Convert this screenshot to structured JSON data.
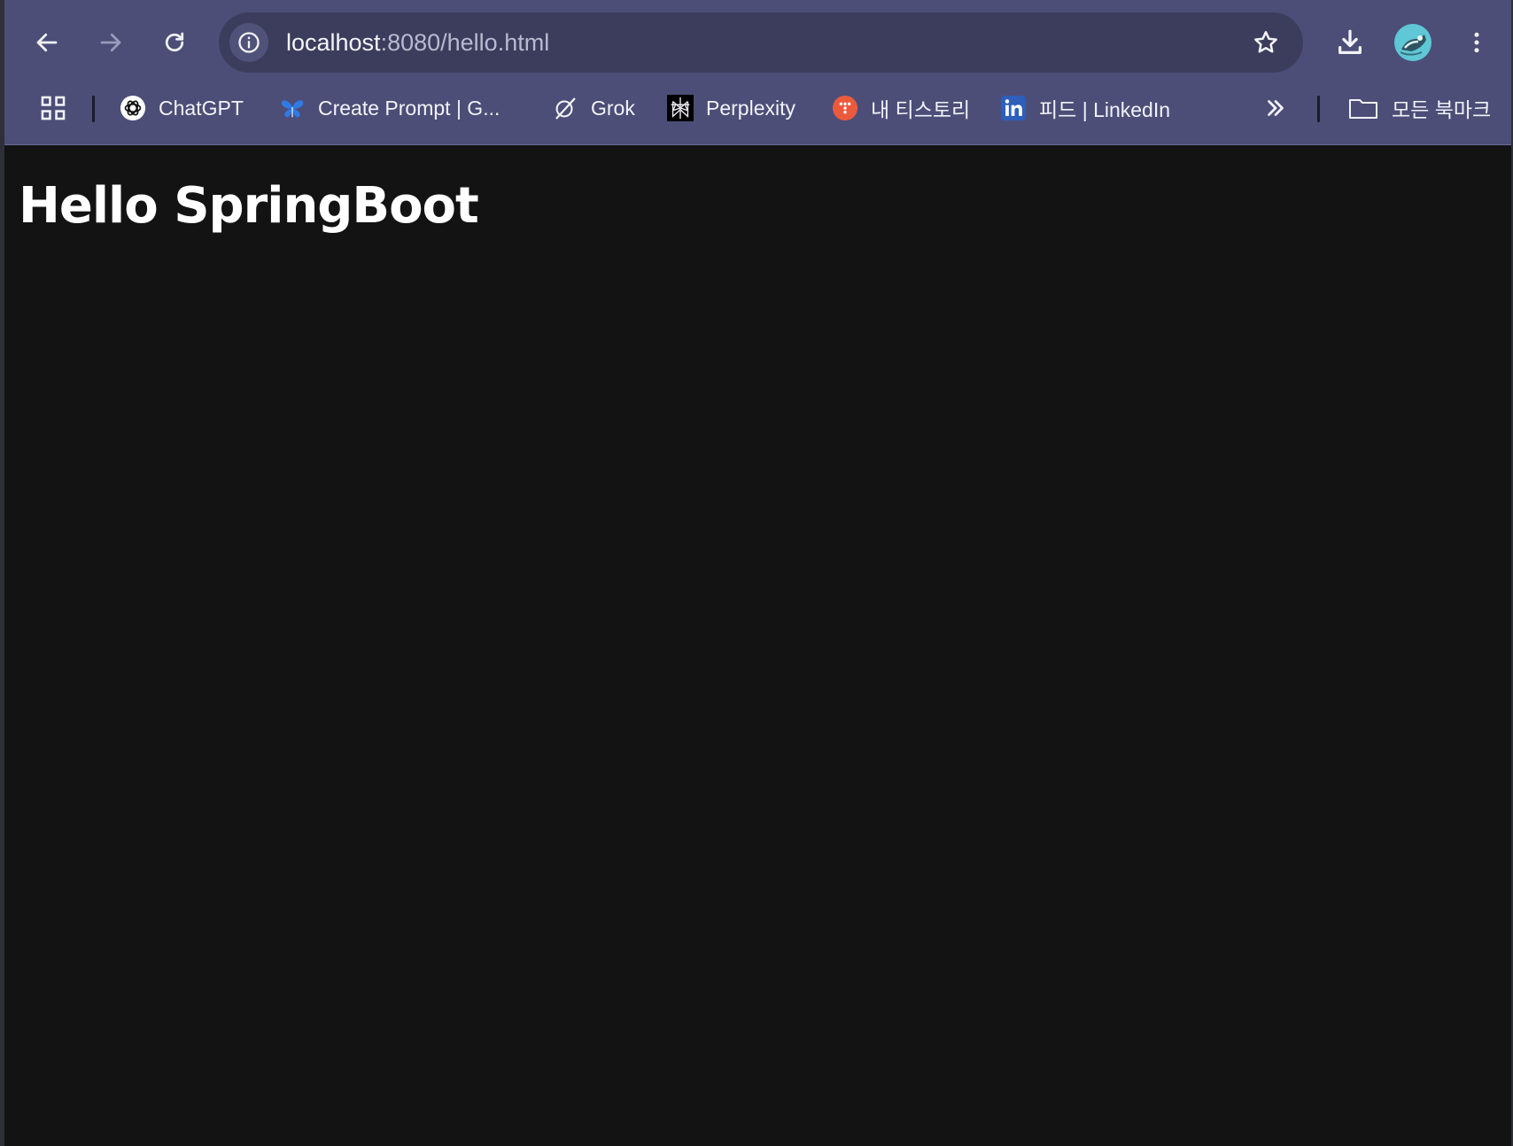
{
  "browser": {
    "url_host": "localhost",
    "url_path": ":8080/hello.html",
    "chrome_color": "#4c4e78",
    "omnibox_color": "#3c3d5c",
    "nav": {
      "back_icon": "arrow-left-icon",
      "forward_icon": "arrow-right-icon",
      "reload_icon": "reload-icon",
      "site_info_icon": "info-icon",
      "bookmark_star_icon": "star-icon",
      "download_icon": "download-icon",
      "profile_icon": "avatar",
      "menu_icon": "kebab-menu-icon"
    }
  },
  "bookmarks": {
    "apps_icon": "apps-grid-icon",
    "items": [
      {
        "label": "ChatGPT",
        "icon": "chatgpt-icon"
      },
      {
        "label": "Create Prompt | G...",
        "icon": "butterfly-icon"
      },
      {
        "label": "Grok",
        "icon": "grok-icon"
      },
      {
        "label": "Perplexity",
        "icon": "perplexity-icon"
      },
      {
        "label": "내 티스토리",
        "icon": "tistory-icon"
      },
      {
        "label": "피드 | LinkedIn",
        "icon": "linkedin-icon"
      }
    ],
    "overflow_icon": "chevron-double-right-icon",
    "all_bookmarks_label": "모든 북마크",
    "all_bookmarks_icon": "folder-icon"
  },
  "page": {
    "heading": "Hello SpringBoot",
    "background": "#131313"
  }
}
